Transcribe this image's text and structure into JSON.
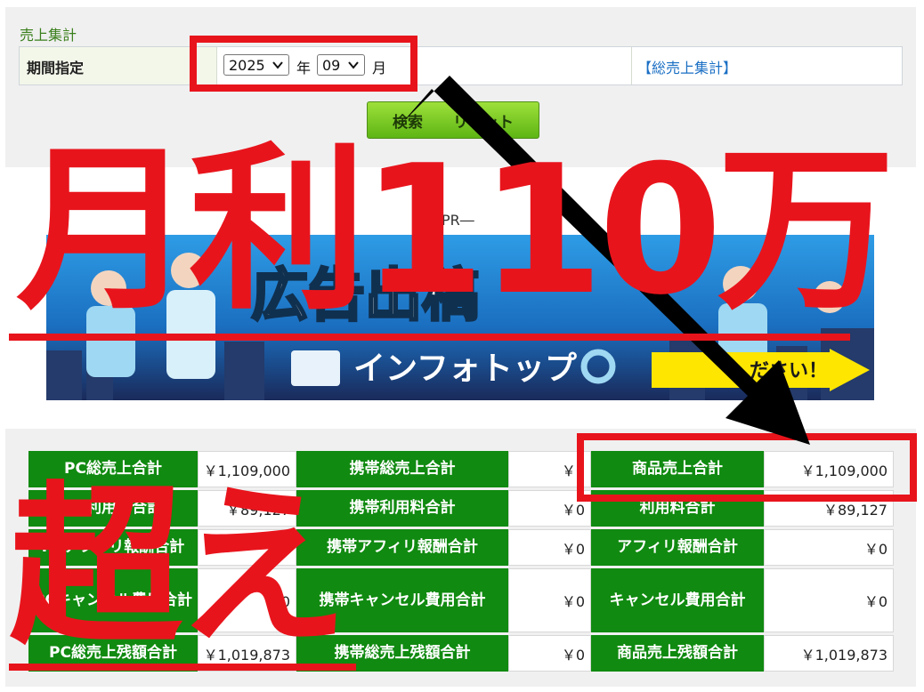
{
  "section_title": "売上集計",
  "filter": {
    "label": "期間指定",
    "year": "2025",
    "year_unit": "年",
    "month": "09",
    "month_unit": "月",
    "total_link": "【総売上集計】"
  },
  "search_button": "検索　　リセット",
  "pr_label": "―PR―",
  "banner": {
    "title": "広告出稿",
    "brand": "インフォトップ",
    "cta": "ださい！"
  },
  "summary": {
    "rows": [
      {
        "pc_label": "PC総売上合計",
        "pc_value": "￥1,109,000",
        "mobile_label": "携帯総売上合計",
        "mobile_value": "￥0",
        "item_label": "商品売上合計",
        "item_value": "￥1,109,000"
      },
      {
        "pc_label": "PC利用料合計",
        "pc_value": "￥89,127",
        "mobile_label": "携帯利用料合計",
        "mobile_value": "￥0",
        "item_label": "利用料合計",
        "item_value": "￥89,127"
      },
      {
        "pc_label": "PCアフィリ報酬合計",
        "pc_value": "￥0",
        "mobile_label": "携帯アフィリ報酬合計",
        "mobile_value": "￥0",
        "item_label": "アフィリ報酬合計",
        "item_value": "￥0"
      },
      {
        "pc_label": "PCキャンセル費用合計",
        "pc_value": "￥0",
        "mobile_label": "携帯キャンセル費用合計",
        "mobile_value": "￥0",
        "item_label": "キャンセル費用合計",
        "item_value": "￥0"
      },
      {
        "pc_label": "PC総売上残額合計",
        "pc_value": "￥1,019,873",
        "mobile_label": "携帯総売上残額合計",
        "mobile_value": "￥0",
        "item_label": "商品売上残額合計",
        "item_value": "￥1,019,873"
      }
    ]
  },
  "overlay": {
    "headline": "月利110万",
    "caption": "超え"
  },
  "colors": {
    "accent_red": "#e8141c",
    "table_green": "#108a10",
    "title_green": "#3a7f1c",
    "link_blue": "#1a6fc4"
  }
}
